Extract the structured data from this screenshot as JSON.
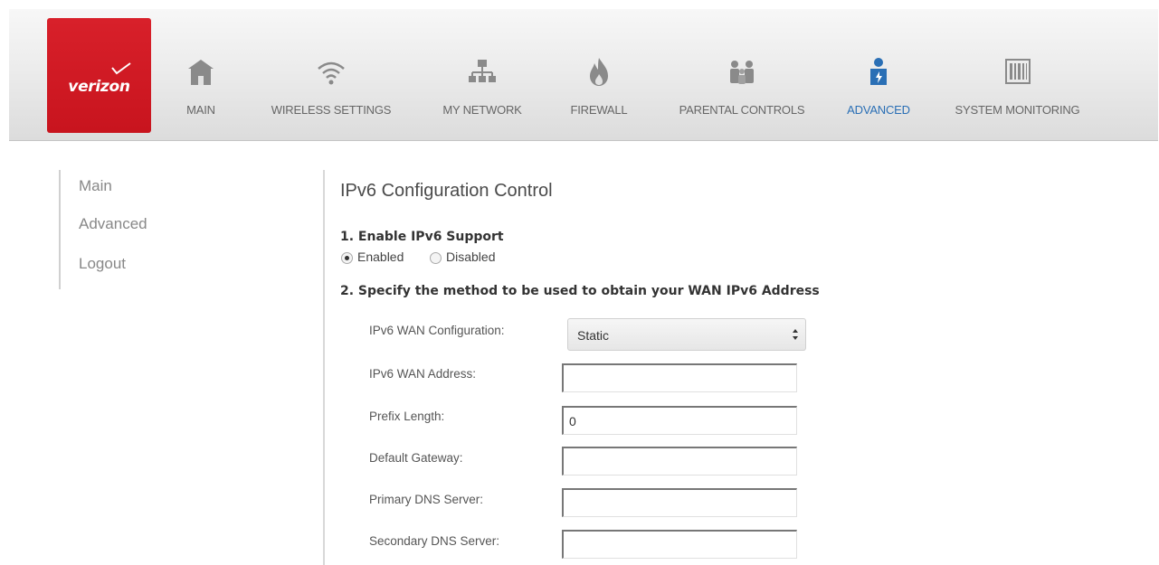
{
  "brand": {
    "logo_text": "verizon",
    "accent_color": "#cd1820",
    "active_color": "#2a6fb5"
  },
  "nav": [
    {
      "label": "MAIN",
      "icon": "home-icon",
      "active": false
    },
    {
      "label": "WIRELESS SETTINGS",
      "icon": "wifi-icon",
      "active": false
    },
    {
      "label": "MY NETWORK",
      "icon": "network-icon",
      "active": false
    },
    {
      "label": "FIREWALL",
      "icon": "flame-icon",
      "active": false
    },
    {
      "label": "PARENTAL CONTROLS",
      "icon": "family-icon",
      "active": false
    },
    {
      "label": "ADVANCED",
      "icon": "advanced-user-icon",
      "active": true
    },
    {
      "label": "SYSTEM MONITORING",
      "icon": "monitor-icon",
      "active": false
    }
  ],
  "sidebar": {
    "items": [
      "Main",
      "Advanced",
      "Logout"
    ]
  },
  "main": {
    "title": "IPv6 Configuration Control",
    "section1": {
      "heading": "1. Enable IPv6 Support",
      "options": [
        "Enabled",
        "Disabled"
      ],
      "selected": "Enabled"
    },
    "section2": {
      "heading": "2. Specify the method to be used to obtain your WAN IPv6 Address",
      "fields": {
        "wan_config": {
          "label": "IPv6 WAN Configuration:",
          "value": "Static"
        },
        "wan_address": {
          "label": "IPv6 WAN Address:",
          "value": ""
        },
        "prefix_length": {
          "label": "Prefix Length:",
          "value": "0"
        },
        "default_gateway": {
          "label": "Default Gateway:",
          "value": ""
        },
        "primary_dns": {
          "label": "Primary DNS Server:",
          "value": ""
        },
        "secondary_dns": {
          "label": "Secondary DNS Server:",
          "value": ""
        }
      }
    }
  }
}
